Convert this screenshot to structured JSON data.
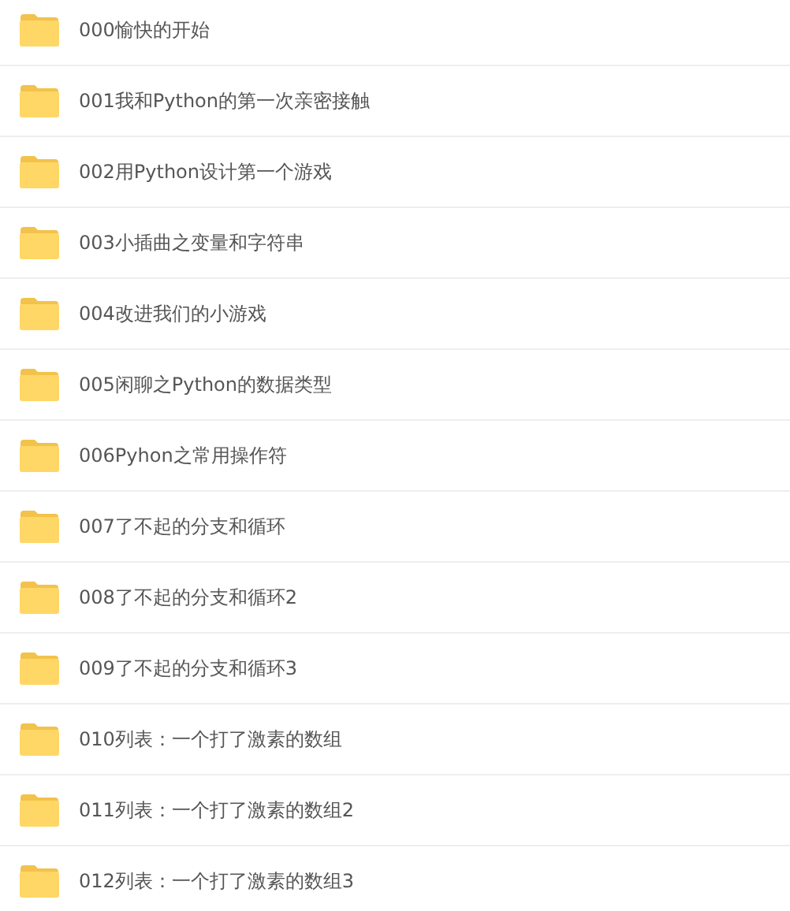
{
  "folders": [
    {
      "name": "000愉快的开始"
    },
    {
      "name": "001我和Python的第一次亲密接触"
    },
    {
      "name": "002用Python设计第一个游戏"
    },
    {
      "name": "003小插曲之变量和字符串"
    },
    {
      "name": "004改进我们的小游戏"
    },
    {
      "name": "005闲聊之Python的数据类型"
    },
    {
      "name": "006Pyhon之常用操作符"
    },
    {
      "name": "007了不起的分支和循环"
    },
    {
      "name": "008了不起的分支和循环2"
    },
    {
      "name": "009了不起的分支和循环3"
    },
    {
      "name": "010列表：一个打了激素的数组"
    },
    {
      "name": "011列表：一个打了激素的数组2"
    },
    {
      "name": "012列表：一个打了激素的数组3"
    }
  ]
}
